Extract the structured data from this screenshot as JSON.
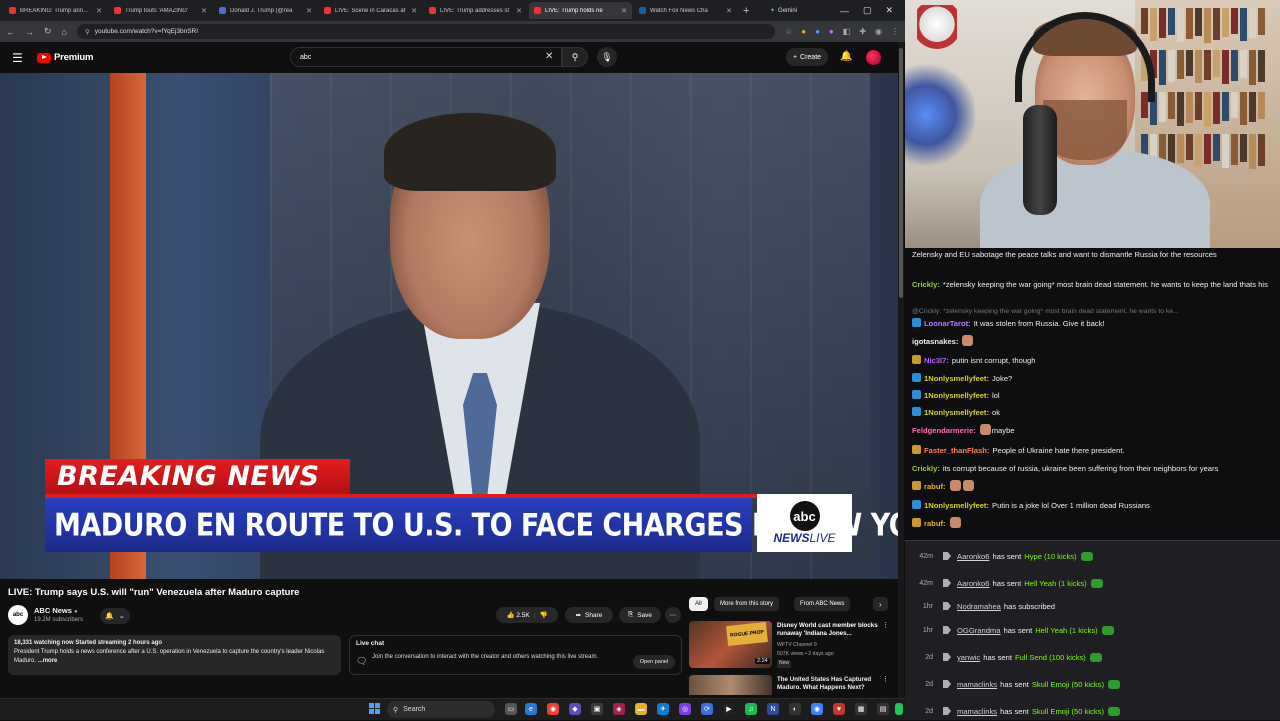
{
  "browser": {
    "tabs": [
      {
        "label": "BREAKING: Trump announ",
        "fav": "#e33"
      },
      {
        "label": "Trump touts 'AMAZING' ",
        "fav": "#e33"
      },
      {
        "label": "Donald J. Trump (@rea",
        "fav": "#4b6ed8"
      },
      {
        "label": "LIVE: Scene in Caracas af",
        "fav": "#e33"
      },
      {
        "label": "LIVE: Trump addresses st",
        "fav": "#e33"
      },
      {
        "label": "LIVE: Trump holds ne",
        "fav": "#e33"
      },
      {
        "label": "Watch Fox News Cha",
        "fav": "#1d5aa8"
      }
    ],
    "new_tab": "+",
    "gemini_tab": "Gemini",
    "url": "youtube.com/watch?v=fYqEj3bnSRI"
  },
  "youtube": {
    "logo_text": "Premium",
    "search_value": "abc",
    "create_label": "Create",
    "video_title": "LIVE: Trump says U.S. will \"run\" Venezuela after Maduro capture",
    "channel_name": "ABC News",
    "channel_subs": "19.2M subscribers",
    "likes": "2.5K",
    "share_label": "Share",
    "save_label": "Save",
    "desc_stats": "18,331 watching now  Started streaming 2 hours ago",
    "desc_text": "President Trump holds a news conference after a U.S. operation in Venezuela to capture the country's leader Nicolas Maduro.",
    "desc_more": "...more",
    "live_chat_title": "Live chat",
    "live_chat_text": "Join the conversation to interact with the creator and others watching this live stream.",
    "open_panel": "Open panel",
    "chips": [
      "All",
      "More from this story",
      "From ABC News"
    ],
    "rec": [
      {
        "title": "Disney World cast member blocks runaway 'Indiana Jones...",
        "channel": "WFTV Channel 9",
        "meta": "507K views • 2 days ago",
        "badge": "New",
        "duration": "2:24",
        "thumb_tag": "ROGUE PROP"
      },
      {
        "title": "The United States Has Captured Maduro. What Happens Next?"
      }
    ]
  },
  "broadcast": {
    "breaking": "BREAKING NEWS",
    "headline": "MADURO EN ROUTE TO U.S. TO FACE CHARGES IN NEW YORK",
    "logo_abc": "abc",
    "logo_news": "NEWS",
    "logo_live": "LIVE"
  },
  "chat": [
    {
      "user": "",
      "color": "#ff4500",
      "text": "Zelensky and EU sabotage the peace talks and want to dismantle Russia for the resources",
      "badge": ""
    },
    {
      "user": "Crickly:",
      "color": "#9acd32",
      "text": "*zelensky keeping the war going* most brain dead statement. he wants to keep the land thats his",
      "badge": ""
    },
    {
      "user": "",
      "color": "#777",
      "text": "@Crickly: *zelensky keeping the war going* most brain dead statement. he wants to ke...",
      "reply": true
    },
    {
      "user": "LoonarTarot:",
      "color": "#b57aff",
      "text": "It was stolen from Russia. Give it back!",
      "badge": "#2a8fd6"
    },
    {
      "user": "igotasnakes:",
      "color": "#efeff1",
      "text": "",
      "badge": ""
    },
    {
      "user": "Nic3l7:",
      "color": "#b05cff",
      "text": "putin isnt corrupt, though",
      "badge": "#c79a2b"
    },
    {
      "user": "1Nonlysmellyfeet:",
      "color": "#d4d41e",
      "text": "Joke?",
      "badge": "#2a8fd6"
    },
    {
      "user": "1Nonlysmellyfeet:",
      "color": "#d4d41e",
      "text": "lol",
      "badge": "#2a8fd6"
    },
    {
      "user": "1Nonlysmellyfeet:",
      "color": "#d4d41e",
      "text": "ok",
      "badge": "#2a8fd6"
    },
    {
      "user": "Feldgendarmerie:",
      "color": "#ff69b4",
      "text": "maybe",
      "badge": ""
    },
    {
      "user": "Faster_thanFlash:",
      "color": "#ff7f50",
      "text": "People of Ukraine hate there president.",
      "badge": "#c79a2b"
    },
    {
      "user": "Crickly:",
      "color": "#9acd32",
      "text": "its corrupt because of russia, ukraine been suffering from their neighbors for years",
      "badge": ""
    },
    {
      "user": "rabuf:",
      "color": "#e6b325",
      "text": "",
      "badge": "#c79a2b"
    },
    {
      "user": "1Nonlysmellyfeet:",
      "color": "#d4d41e",
      "text": "Putin is a joke lol Over 1 million dead Russians",
      "badge": "#2a8fd6"
    },
    {
      "user": "rabuf:",
      "color": "#e6b325",
      "text": "",
      "badge": "#c79a2b"
    }
  ],
  "events": [
    {
      "time": "42m",
      "name": "Aaronko6",
      "verb": "has sent",
      "gift": "Hype (10 kicks)"
    },
    {
      "time": "42m",
      "name": "Aaronko6",
      "verb": "has sent",
      "gift": "Hell Yeah (1 kicks)"
    },
    {
      "time": "1hr",
      "name": "Nodramahea",
      "verb": "has subscribed",
      "gift": ""
    },
    {
      "time": "1hr",
      "name": "OGGrandma",
      "verb": "has sent",
      "gift": "Hell Yeah (1 kicks)"
    },
    {
      "time": "2d",
      "name": "yanwic",
      "verb": "has sent",
      "gift": "Full Send (100 kicks)"
    },
    {
      "time": "2d",
      "name": "mamaclinks",
      "verb": "has sent",
      "gift": "Skull Emoji (50 kicks)"
    },
    {
      "time": "2d",
      "name": "mamaclinks",
      "verb": "has sent",
      "gift": "Skull Emoji (50 kicks)"
    }
  ],
  "taskbar": {
    "search": "Search"
  }
}
